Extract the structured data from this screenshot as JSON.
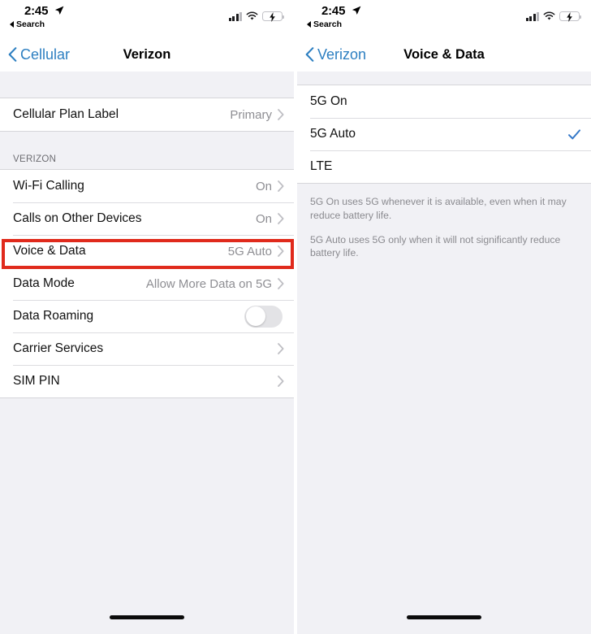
{
  "status_bar": {
    "time": "2:45",
    "back_app": "Search",
    "location_icon": "location-arrow-icon",
    "signal_icon": "cellular-signal-icon",
    "wifi_icon": "wifi-icon",
    "battery_icon": "battery-charging-icon"
  },
  "left_panel": {
    "nav": {
      "back_label": "Cellular",
      "title": "Verizon"
    },
    "plan_list": [
      {
        "label": "Cellular Plan Label",
        "value": "Primary",
        "accessory": "chevron"
      }
    ],
    "section_header": "VERIZON",
    "carrier_list": [
      {
        "label": "Wi-Fi Calling",
        "value": "On",
        "accessory": "chevron"
      },
      {
        "label": "Calls on Other Devices",
        "value": "On",
        "accessory": "chevron"
      },
      {
        "label": "Voice & Data",
        "value": "5G Auto",
        "accessory": "chevron"
      },
      {
        "label": "Data Mode",
        "value": "Allow More Data on 5G",
        "accessory": "chevron"
      },
      {
        "label": "Data Roaming",
        "value": "",
        "accessory": "toggle-off"
      },
      {
        "label": "Carrier Services",
        "value": "",
        "accessory": "chevron"
      },
      {
        "label": "SIM PIN",
        "value": "",
        "accessory": "chevron"
      }
    ]
  },
  "right_panel": {
    "nav": {
      "back_label": "Verizon",
      "title": "Voice & Data"
    },
    "options": [
      {
        "label": "5G On",
        "selected": false
      },
      {
        "label": "5G Auto",
        "selected": true
      },
      {
        "label": "LTE",
        "selected": false
      }
    ],
    "footer_notes": [
      "5G On uses 5G whenever it is available, even when it may reduce battery life.",
      "5G Auto uses 5G only when it will not significantly reduce battery life."
    ]
  },
  "annotation": {
    "highlight_color": "#e02a1c",
    "highlight_target": "Voice & Data"
  },
  "colors": {
    "tint_blue": "#2d7fc1",
    "check_blue": "#3478c8",
    "battery_green": "#30d158",
    "group_bg": "#f1f1f5"
  }
}
